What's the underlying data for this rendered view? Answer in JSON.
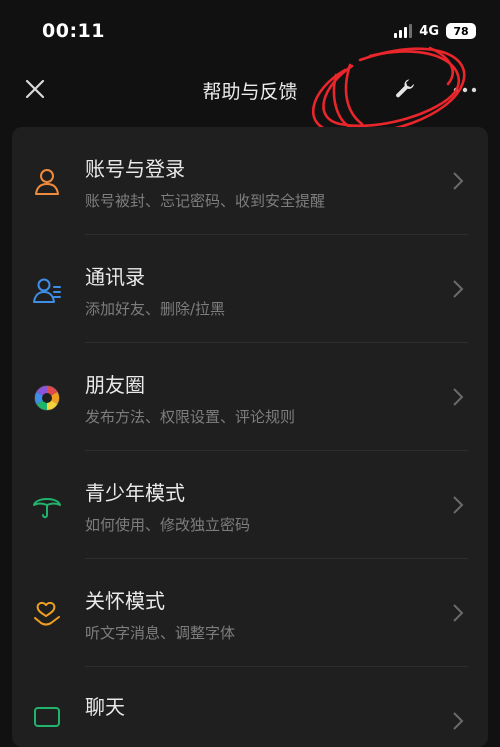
{
  "status_bar": {
    "time": "00:11",
    "network": "4G",
    "battery": "78"
  },
  "nav": {
    "title": "帮助与反馈"
  },
  "menu": [
    {
      "title": "账号与登录",
      "subtitle": "账号被封、忘记密码、收到安全提醒",
      "icon": "user-icon",
      "color": "#f08a3c"
    },
    {
      "title": "通讯录",
      "subtitle": "添加好友、删除/拉黑",
      "icon": "contacts-icon",
      "color": "#3e8ee8"
    },
    {
      "title": "朋友圈",
      "subtitle": "发布方法、权限设置、评论规则",
      "icon": "moments-aperture-icon",
      "color": "#e04a4a"
    },
    {
      "title": "青少年模式",
      "subtitle": "如何使用、修改独立密码",
      "icon": "umbrella-icon",
      "color": "#21b36b"
    },
    {
      "title": "关怀模式",
      "subtitle": "听文字消息、调整字体",
      "icon": "care-hand-heart-icon",
      "color": "#f0a020"
    },
    {
      "title": "聊天",
      "subtitle": "",
      "icon": "chat-icon",
      "color": "#21b36b"
    }
  ]
}
